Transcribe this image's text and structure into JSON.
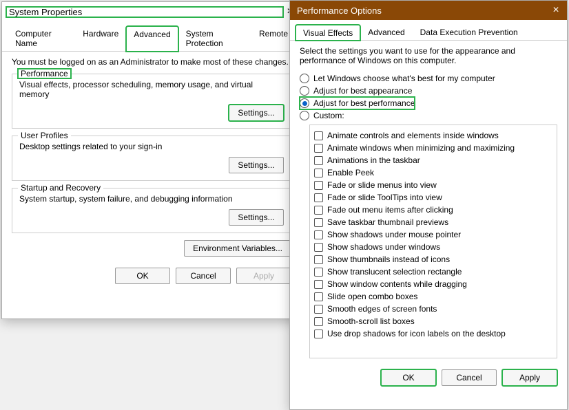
{
  "sys": {
    "title": "System Properties",
    "tabs": [
      "Computer Name",
      "Hardware",
      "Advanced",
      "System Protection",
      "Remote"
    ],
    "note": "You must be logged on as an Administrator to make most of these changes.",
    "groups": {
      "performance": {
        "title": "Performance",
        "desc": "Visual effects, processor scheduling, memory usage, and virtual memory",
        "btn": "Settings..."
      },
      "userprofiles": {
        "title": "User Profiles",
        "desc": "Desktop settings related to your sign-in",
        "btn": "Settings..."
      },
      "startup": {
        "title": "Startup and Recovery",
        "desc": "System startup, system failure, and debugging information",
        "btn": "Settings..."
      }
    },
    "envbtn": "Environment Variables...",
    "buttons": {
      "ok": "OK",
      "cancel": "Cancel",
      "apply": "Apply"
    }
  },
  "perf": {
    "title": "Performance Options",
    "tabs": [
      "Visual Effects",
      "Advanced",
      "Data Execution Prevention"
    ],
    "desc": "Select the settings you want to use for the appearance and performance of Windows on this computer.",
    "radios": [
      "Let Windows choose what's best for my computer",
      "Adjust for best appearance",
      "Adjust for best performance",
      "Custom:"
    ],
    "checks": [
      "Animate controls and elements inside windows",
      "Animate windows when minimizing and maximizing",
      "Animations in the taskbar",
      "Enable Peek",
      "Fade or slide menus into view",
      "Fade or slide ToolTips into view",
      "Fade out menu items after clicking",
      "Save taskbar thumbnail previews",
      "Show shadows under mouse pointer",
      "Show shadows under windows",
      "Show thumbnails instead of icons",
      "Show translucent selection rectangle",
      "Show window contents while dragging",
      "Slide open combo boxes",
      "Smooth edges of screen fonts",
      "Smooth-scroll list boxes",
      "Use drop shadows for icon labels on the desktop"
    ],
    "buttons": {
      "ok": "OK",
      "cancel": "Cancel",
      "apply": "Apply"
    }
  }
}
